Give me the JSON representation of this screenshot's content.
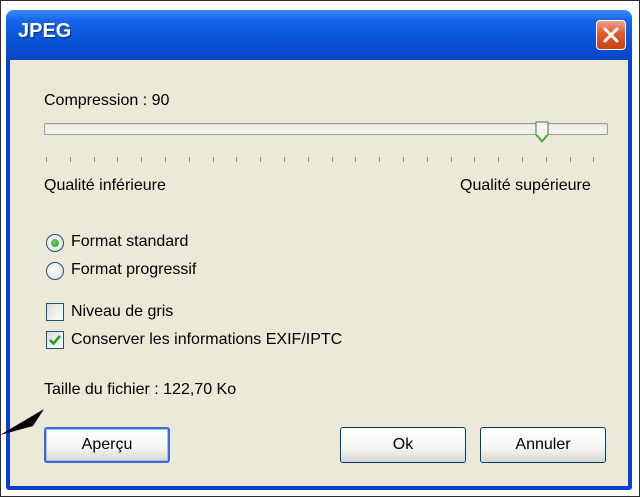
{
  "window": {
    "title": "JPEG",
    "close_icon": "close-icon"
  },
  "compression": {
    "label": "Compression : 90",
    "value": 90,
    "min_label": "Qualité inférieure",
    "max_label": "Qualité supérieure"
  },
  "format": {
    "standard_label": "Format standard",
    "standard_selected": true,
    "progressive_label": "Format progressif",
    "progressive_selected": false
  },
  "options": {
    "grayscale_label": "Niveau de gris",
    "grayscale_checked": false,
    "exif_label": "Conserver les informations EXIF/IPTC",
    "exif_checked": true
  },
  "file_size_label": "Taille du fichier : 122,70 Ko",
  "buttons": {
    "preview": "Aperçu",
    "ok": "Ok",
    "cancel": "Annuler"
  },
  "colors": {
    "titlebar": "#0756d9",
    "dialog_background": "#ece9d8",
    "close_button": "#de5a2c",
    "check_green": "#21a121"
  }
}
